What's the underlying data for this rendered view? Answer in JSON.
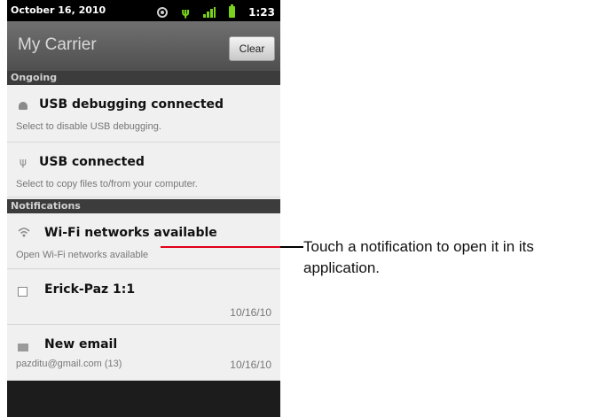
{
  "status_bar": {
    "date": "October 16, 2010",
    "time": "1:23",
    "icons": [
      "gps-icon",
      "usb-icon",
      "signal-icon",
      "battery-icon"
    ],
    "accent_color": "#7bd21a"
  },
  "header": {
    "carrier": "My Carrier",
    "clear_label": "Clear"
  },
  "sections": {
    "ongoing": "Ongoing",
    "notifications": "Notifications"
  },
  "ongoing_items": [
    {
      "icon": "android-icon",
      "title": "USB debugging connected",
      "subtitle": "Select to disable USB debugging."
    },
    {
      "icon": "usb-icon",
      "title": "USB connected",
      "subtitle": "Select to copy files to/from your computer."
    }
  ],
  "notification_items": [
    {
      "icon": "wifi-icon",
      "title": "Wi-Fi networks available",
      "subtitle": "Open Wi-Fi networks available",
      "time": ""
    },
    {
      "icon": "calendar-icon",
      "title": "Erick-Paz 1:1",
      "subtitle": "",
      "time": "10/16/10"
    },
    {
      "icon": "mail-icon",
      "title": "New email",
      "subtitle": "pazditu@gmail.com (13)",
      "time": "10/16/10"
    }
  ],
  "callout": {
    "text": "Touch a notification to open it in its application.",
    "line_color": "#e2001a"
  }
}
